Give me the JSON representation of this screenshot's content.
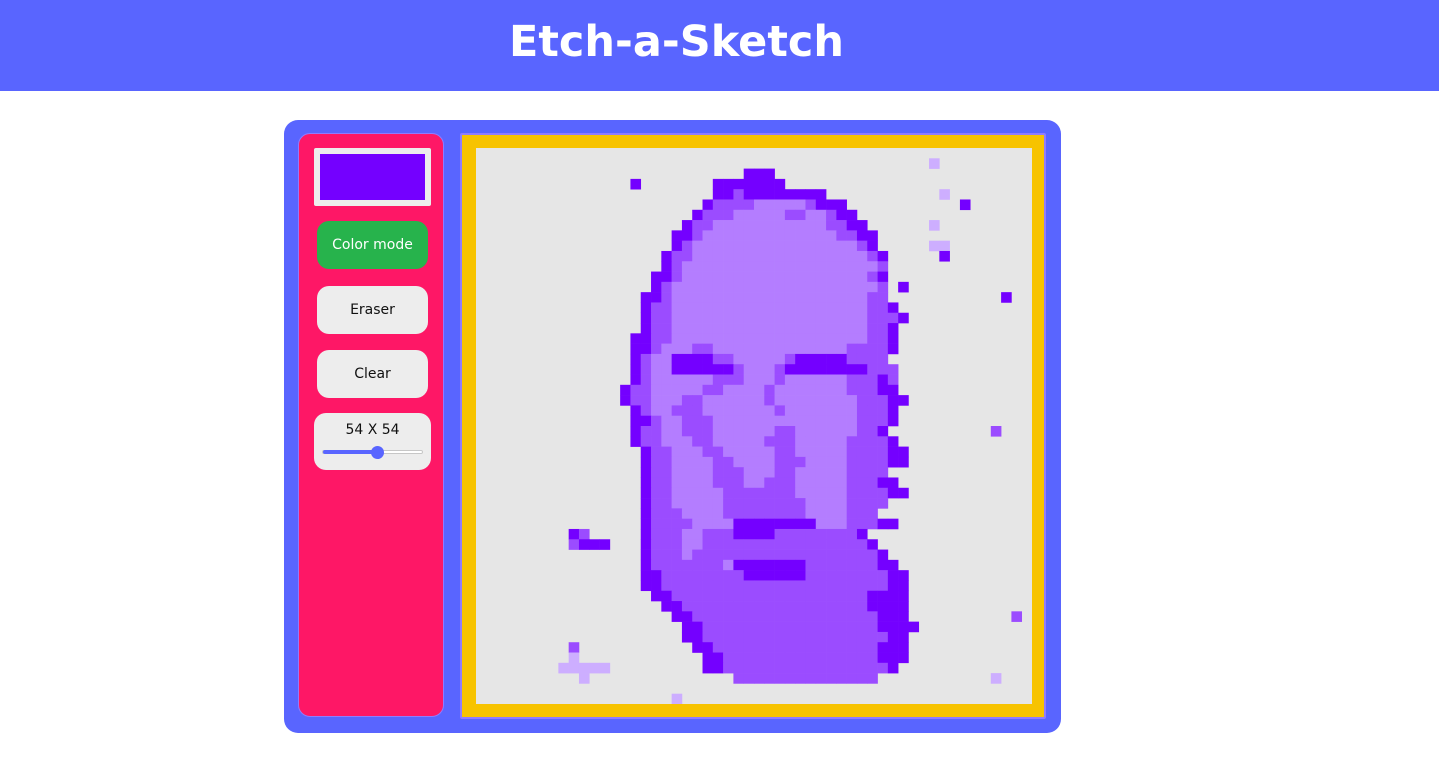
{
  "header": {
    "title": "Etch-a-Sketch"
  },
  "controls": {
    "current_color": "#7400ff",
    "color_mode_label": "Color mode",
    "eraser_label": "Eraser",
    "clear_label": "Clear",
    "grid_size_label": "54 X 54",
    "grid_size": 54,
    "grid_size_min": 1,
    "grid_size_max": 100,
    "active_mode": "color"
  },
  "colors": {
    "header_bg": "#5965ff",
    "panel_bg": "#fe1766",
    "active_button": "#27b34c",
    "board_frame": "#f7c300",
    "board_bg": "#e6e6e6",
    "ink": "#7400ff"
  },
  "drawing": {
    "grid": 54,
    "palette": [
      "#7400ff",
      "#9b4cff",
      "#b47dff",
      "#cdaeff",
      "#e0d6fa"
    ],
    "rows": [
      "......................................................",
      "............................................4.........",
      "..........................111.........................",
      "...............1.......1111111.......................",
      ".......................11211111111...........4........",
      "......................12222333332111...........1......",
      ".....................1222333332233211.................",
      "....................122333333333332211......4.........",
      "...................11233333333333332211...............",
      "...................12333333333333333321.....44........",
      "..................1223333333333333333321.....1........",
      "..................1233333333333333333332..............",
      ".................11233333333333333333321..............",
      ".................12333333333333333333332.1............",
      "................112333333333333333333322...........1..",
      "................1223333333333333333333221.............",
      "................12233333333333333333332221............",
      "................1223333333333333333333221.............",
      "...............11223333333333333333333221.............",
      "...............11233322333333333333322221.............",
      "...............1233111122333332111112222..............",
      "...............12331111112333211111111222.............",
      "...............12333333222333233333322212.............",
      "..............122333332233332333333322211.............",
      "..............1223332233333323333333322211............",
      "...............12332223333333233333332221.............",
      "...............11233222333333333333332221.............",
      "...............1223322233333322333333221..........2...",
      "...............12233322333332223333322221.............",
      "................12233322333332233333222211............",
      "................12233332233332223333222211............",
      "................122333322233322333332222..............",
      "................1223333222332223333322211.............",
      "................12233333222222233333222211............",
      "................122333332222222233332222..............",
      "................12223333222222223333222...............",
      "................1222233331111111133322211.............",
      ".........12.....1222332221111222222221...............",
      ".........2111...12223322222222222222221...............",
      "................122232222222222222222221..............",
      "................1222222231111111222222211.............",
      "................11222222221111112222222211............",
      "................11222222222222222222222211............",
      ".................1122222222222222222221111............",
      "..................112222222222222222221111............",
      "...................11222222222222222222111..........2.",
      "....................11222222222222222221111...........",
      "....................1122222222222222222211............",
      ".........2...........112222222222222222111............",
      ".........4............11222222222222222111............",
      "........44444.........1122222222222222221.............",
      "..........4..............22222222222222...........4...",
      "......................................................",
      "...................4.................................."
    ]
  }
}
